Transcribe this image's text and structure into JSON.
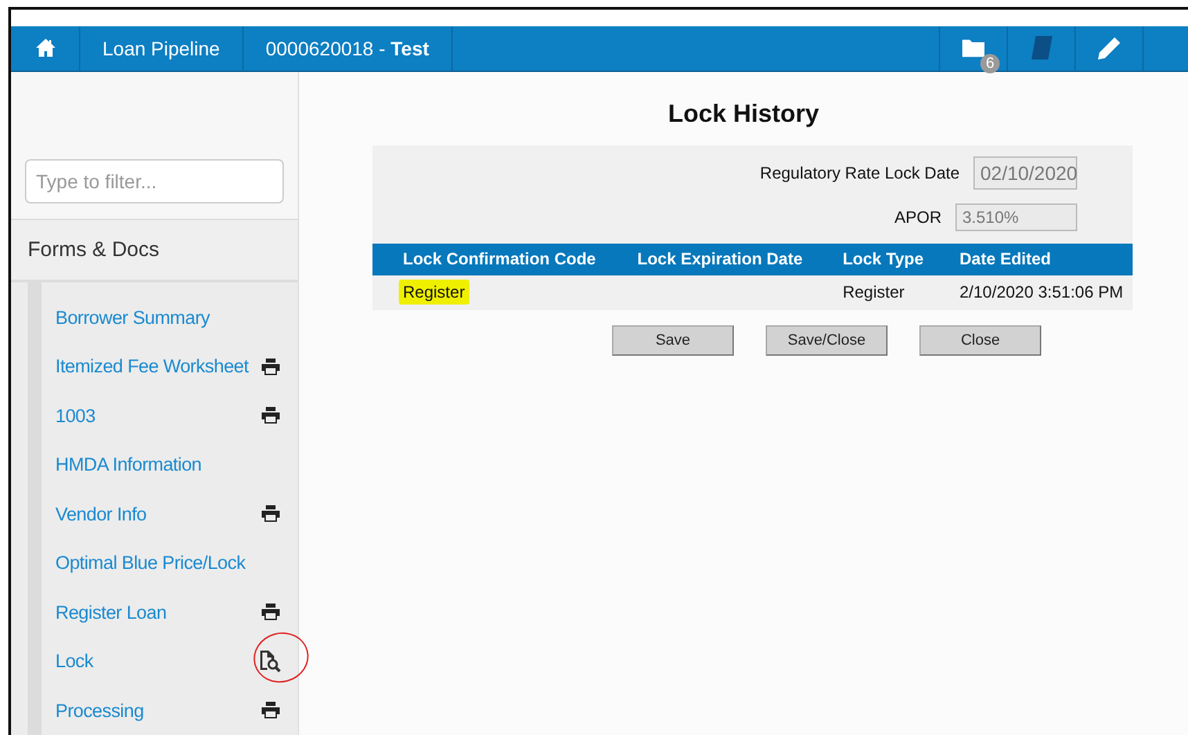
{
  "nav": {
    "items": [
      {
        "kind": "home"
      },
      {
        "kind": "link",
        "label": "Loan Pipeline"
      },
      {
        "kind": "loan",
        "number": "0000620018 - ",
        "name": "Test"
      }
    ],
    "tools": [
      {
        "kind": "folder",
        "badge": "6"
      },
      {
        "kind": "book"
      },
      {
        "kind": "pencil"
      },
      {
        "kind": "blank"
      }
    ]
  },
  "sidebar": {
    "filter": {
      "placeholder": "Type to filter..."
    },
    "section": "Forms & Docs",
    "items": [
      {
        "label": "Borrower Summary",
        "kind": "plain",
        "circled": false
      },
      {
        "label": "Itemized Fee Worksheet",
        "kind": "print",
        "circled": false
      },
      {
        "label": "1003",
        "kind": "print",
        "circled": false
      },
      {
        "label": "HMDA Information",
        "kind": "plain",
        "circled": false
      },
      {
        "label": "Vendor Info",
        "kind": "print",
        "circled": false
      },
      {
        "label": "Optimal Blue Price/Lock",
        "kind": "plain",
        "circled": false
      },
      {
        "label": "Register Loan",
        "kind": "print",
        "circled": false
      },
      {
        "label": "Lock",
        "kind": "preview",
        "circled": true
      },
      {
        "label": "Processing",
        "kind": "print",
        "circled": false
      }
    ]
  },
  "lock_history": {
    "title": "Lock History",
    "fields": [
      {
        "label": "Regulatory Rate Lock Date",
        "value": "02/10/2020"
      },
      {
        "label": "APOR",
        "value": "3.510%"
      }
    ],
    "table": {
      "columns": [
        "Lock Confirmation Code",
        "Lock Expiration Date",
        "Lock Type",
        "Date Edited"
      ],
      "rows": [
        {
          "cells": [
            {
              "text": "Register",
              "highlighted": true
            },
            null,
            {
              "text": "Register",
              "highlighted": false
            },
            {
              "text": "2/10/2020 3:51:06 PM",
              "highlighted": false
            }
          ]
        }
      ]
    },
    "buttons": [
      "Save",
      "Save/Close",
      "Close"
    ]
  }
}
